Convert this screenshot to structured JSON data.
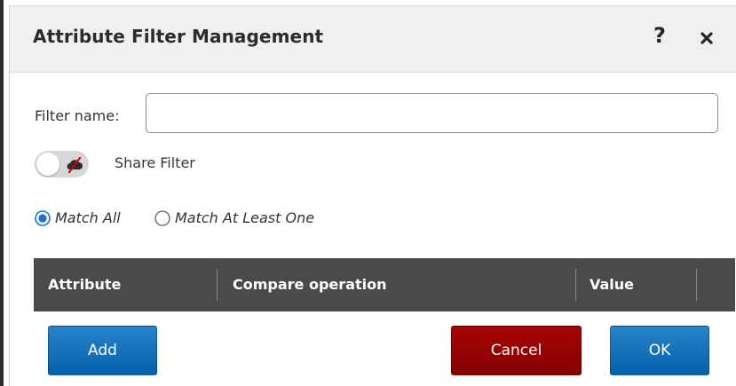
{
  "dialog": {
    "title": "Attribute Filter Management",
    "help_label": "?",
    "close_icon": "close-icon"
  },
  "form": {
    "filter_name_label": "Filter name:",
    "filter_name_value": "",
    "share_toggle_on": false,
    "share_icon": "cloud-slash-icon",
    "share_label": "Share Filter"
  },
  "match": {
    "selected": "Match All",
    "options": [
      "Match All",
      "Match At Least One"
    ]
  },
  "grid": {
    "columns": [
      "Attribute",
      "Compare operation",
      "Value"
    ],
    "rows": []
  },
  "actions": {
    "add_label": "Add",
    "cancel_label": "Cancel",
    "ok_label": "OK"
  },
  "colors": {
    "primary_button": "#0a6fb7",
    "cancel_button": "#900000",
    "grid_header": "#4a4a4a",
    "radio_selected": "#1674d1"
  }
}
